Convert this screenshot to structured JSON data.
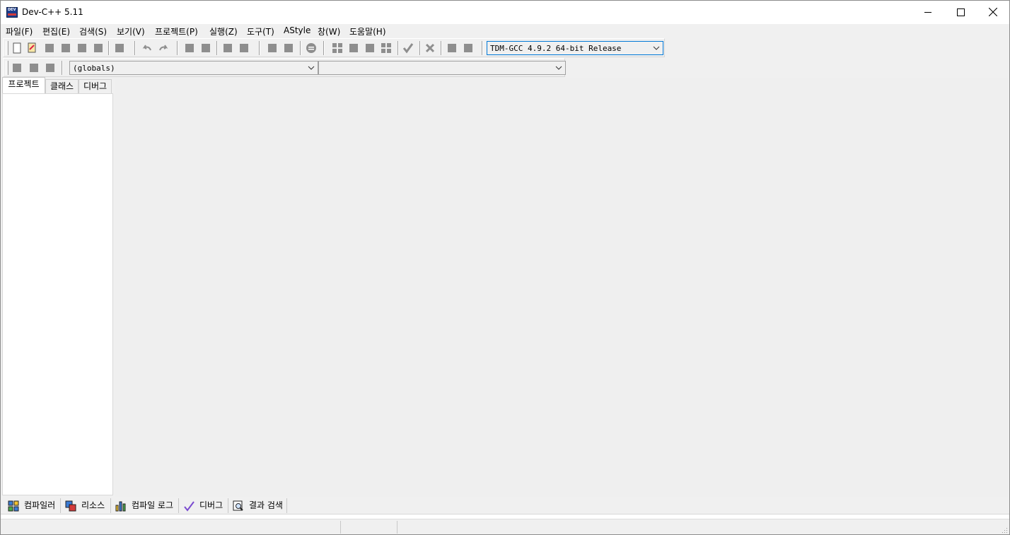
{
  "window": {
    "title": "Dev-C++ 5.11"
  },
  "menu": [
    "파일(F)",
    "편집(E)",
    "검색(S)",
    "보기(V)",
    "프로젝트(P)",
    "실행(Z)",
    "도구(T)",
    "AStyle",
    "창(W)",
    "도움말(H)"
  ],
  "toolbar": {
    "compiler_select": "TDM-GCC 4.9.2 64-bit Release",
    "class_scope_select": "(globals)",
    "member_select": ""
  },
  "left_tabs": [
    "프로젝트",
    "클래스",
    "디버그"
  ],
  "bottom_tabs": [
    {
      "label": "컴파일러",
      "icon": "compiler-grid-icon"
    },
    {
      "label": "리소스",
      "icon": "resources-icon"
    },
    {
      "label": "컴파일 로그",
      "icon": "compile-log-chart-icon"
    },
    {
      "label": "디버그",
      "icon": "debug-check-icon"
    },
    {
      "label": "결과 검색",
      "icon": "search-results-icon"
    }
  ],
  "colors": {
    "focus_border": "#0078d7",
    "toolbar_icon": "#8e8e8e"
  }
}
